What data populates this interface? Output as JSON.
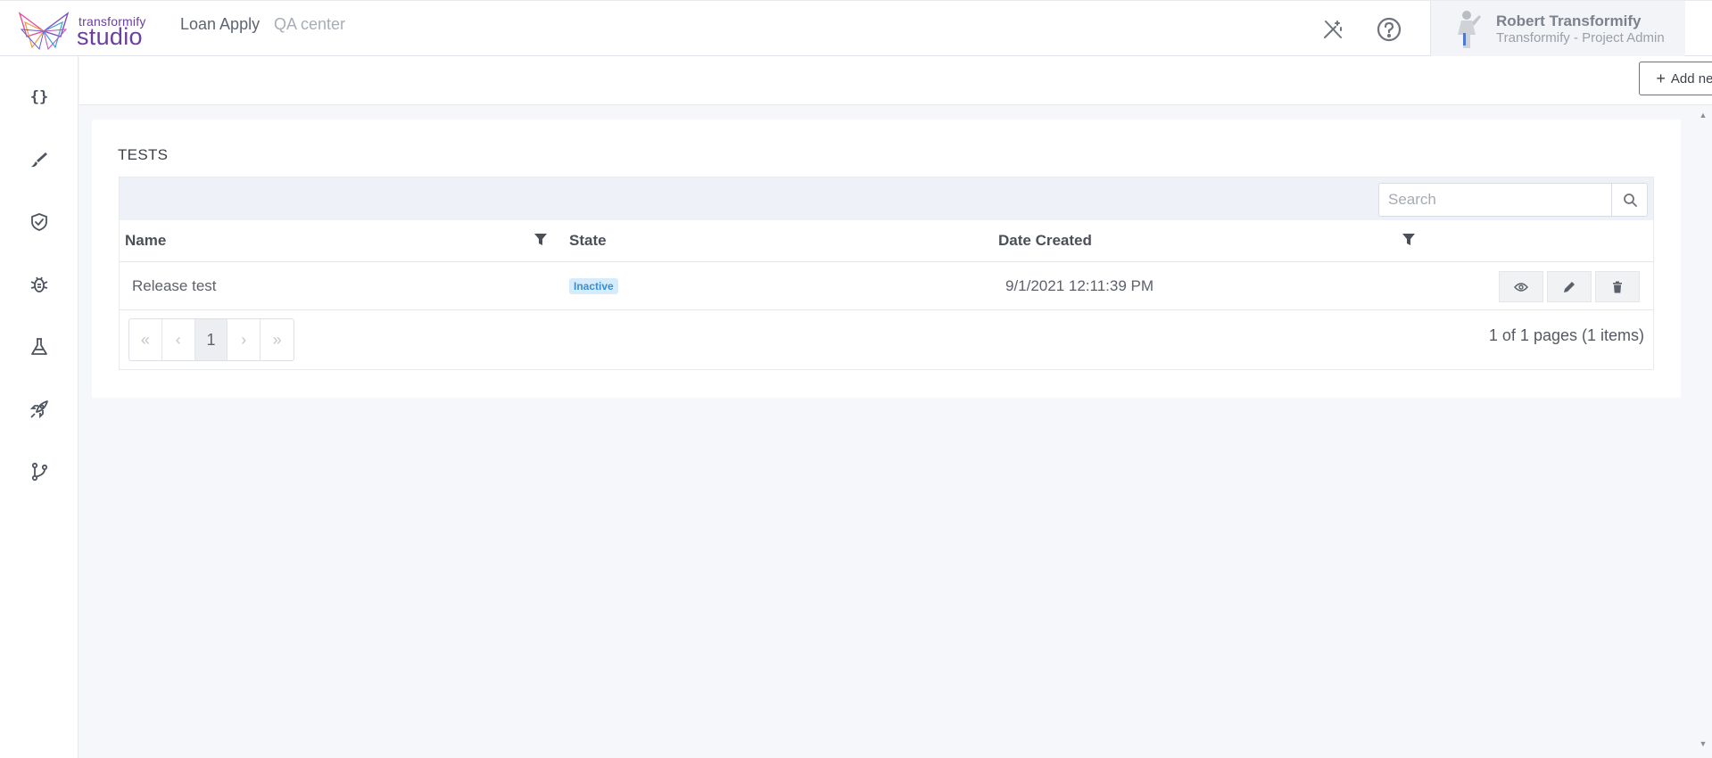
{
  "header": {
    "logo_top": "transformify",
    "logo_main": "studio",
    "project_link": "Loan Apply",
    "section_link": "QA center",
    "user": {
      "name": "Robert Transformify",
      "role": "Transformify - Project Admin"
    }
  },
  "sidebar": {
    "items": [
      {
        "icon": "braces-icon",
        "glyph": "{}"
      },
      {
        "icon": "brush-icon"
      },
      {
        "icon": "shield-check-icon"
      },
      {
        "icon": "bug-icon"
      },
      {
        "icon": "flask-icon"
      },
      {
        "icon": "rocket-icon"
      },
      {
        "icon": "git-branch-icon"
      }
    ]
  },
  "toolbar": {
    "add_label": "Add new test"
  },
  "tests": {
    "title": "TESTS",
    "search_placeholder": "Search",
    "columns": [
      "Name",
      "State",
      "Date Created"
    ],
    "rows": [
      {
        "name": "Release test",
        "state": "Inactive",
        "date": "9/1/2021 12:11:39 PM"
      }
    ],
    "pager": {
      "current_page": "1",
      "info": "1 of 1 pages (1 items)"
    }
  },
  "colors": {
    "brand": "#6a3fa0",
    "badge_bg": "#d6ecfa",
    "badge_text": "#3a8fd0"
  }
}
